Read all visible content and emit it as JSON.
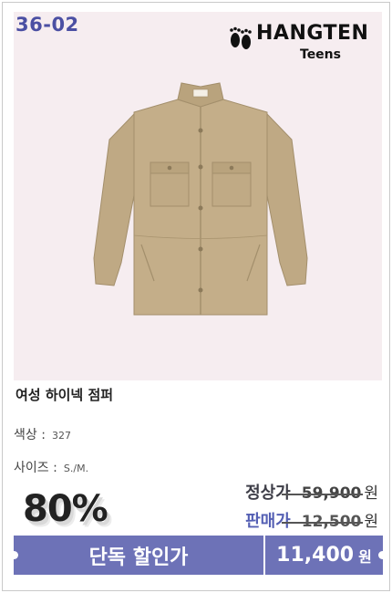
{
  "product": {
    "code": "36-02",
    "brand_name": "HANGTEN",
    "brand_sub": "Teens",
    "title": "여성 하이넥 점퍼",
    "color_label": "색상 :",
    "color_value": "327",
    "size_label": "사이즈 :",
    "size_value": "S./M."
  },
  "pricing": {
    "discount": "80%",
    "regular_label": "정상가",
    "regular_price": "59,900",
    "regular_unit": "원",
    "sale_label": "판매가",
    "sale_price": "12,500",
    "sale_unit": "원"
  },
  "promo_bar": {
    "label": "단독 할인가",
    "price": "11,400",
    "unit": "원"
  },
  "colors": {
    "accent": "#6d72b7",
    "code_text": "#4b4fa3",
    "image_bg": "#f6edf0",
    "jacket": "#c2ac87"
  },
  "icons": {
    "brand": "feet-icon"
  }
}
